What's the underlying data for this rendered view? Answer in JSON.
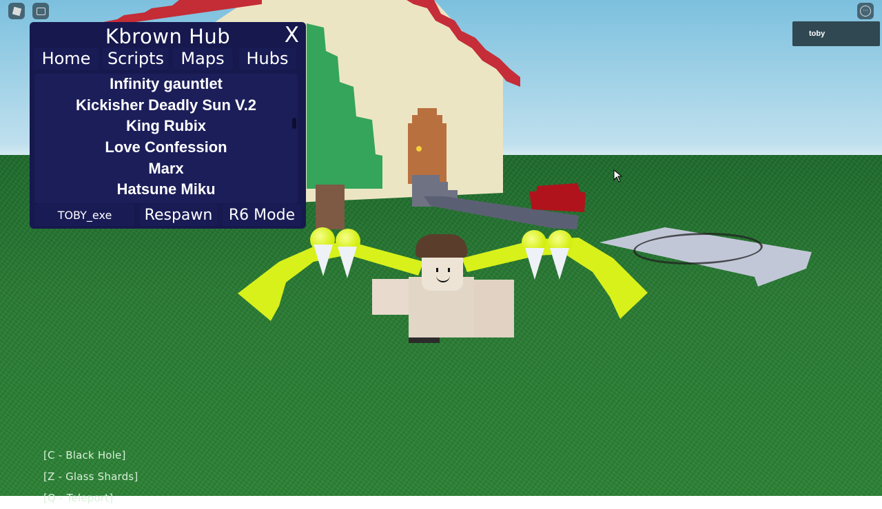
{
  "hub": {
    "title": "Kbrown Hub",
    "close_label": "X",
    "tabs": [
      {
        "label": "Home"
      },
      {
        "label": "Scripts"
      },
      {
        "label": "Maps"
      },
      {
        "label": "Hubs"
      }
    ],
    "scripts": [
      "Infinity gauntlet",
      "Kickisher Deadly Sun V.2",
      "King Rubix",
      "Love Confession",
      "Marx",
      "Hatsune Miku"
    ],
    "footer": {
      "username": "TOBY_exe",
      "respawn_label": "Respawn",
      "r6_label": "R6 Mode"
    }
  },
  "roblox": {
    "menu_icon": "roblox-logo-icon",
    "chat_icon": "chat-icon",
    "more_icon": "more-options-icon",
    "player_list": [
      "toby"
    ]
  },
  "keybinds": [
    "[C - Black Hole]",
    "[Z - Glass Shards]",
    "[Q - Teleport]"
  ],
  "colors": {
    "hub_bg": "#16184e",
    "hub_panel": "#1c1e5a",
    "text": "#ffffff",
    "claw": "#d8f11b"
  }
}
